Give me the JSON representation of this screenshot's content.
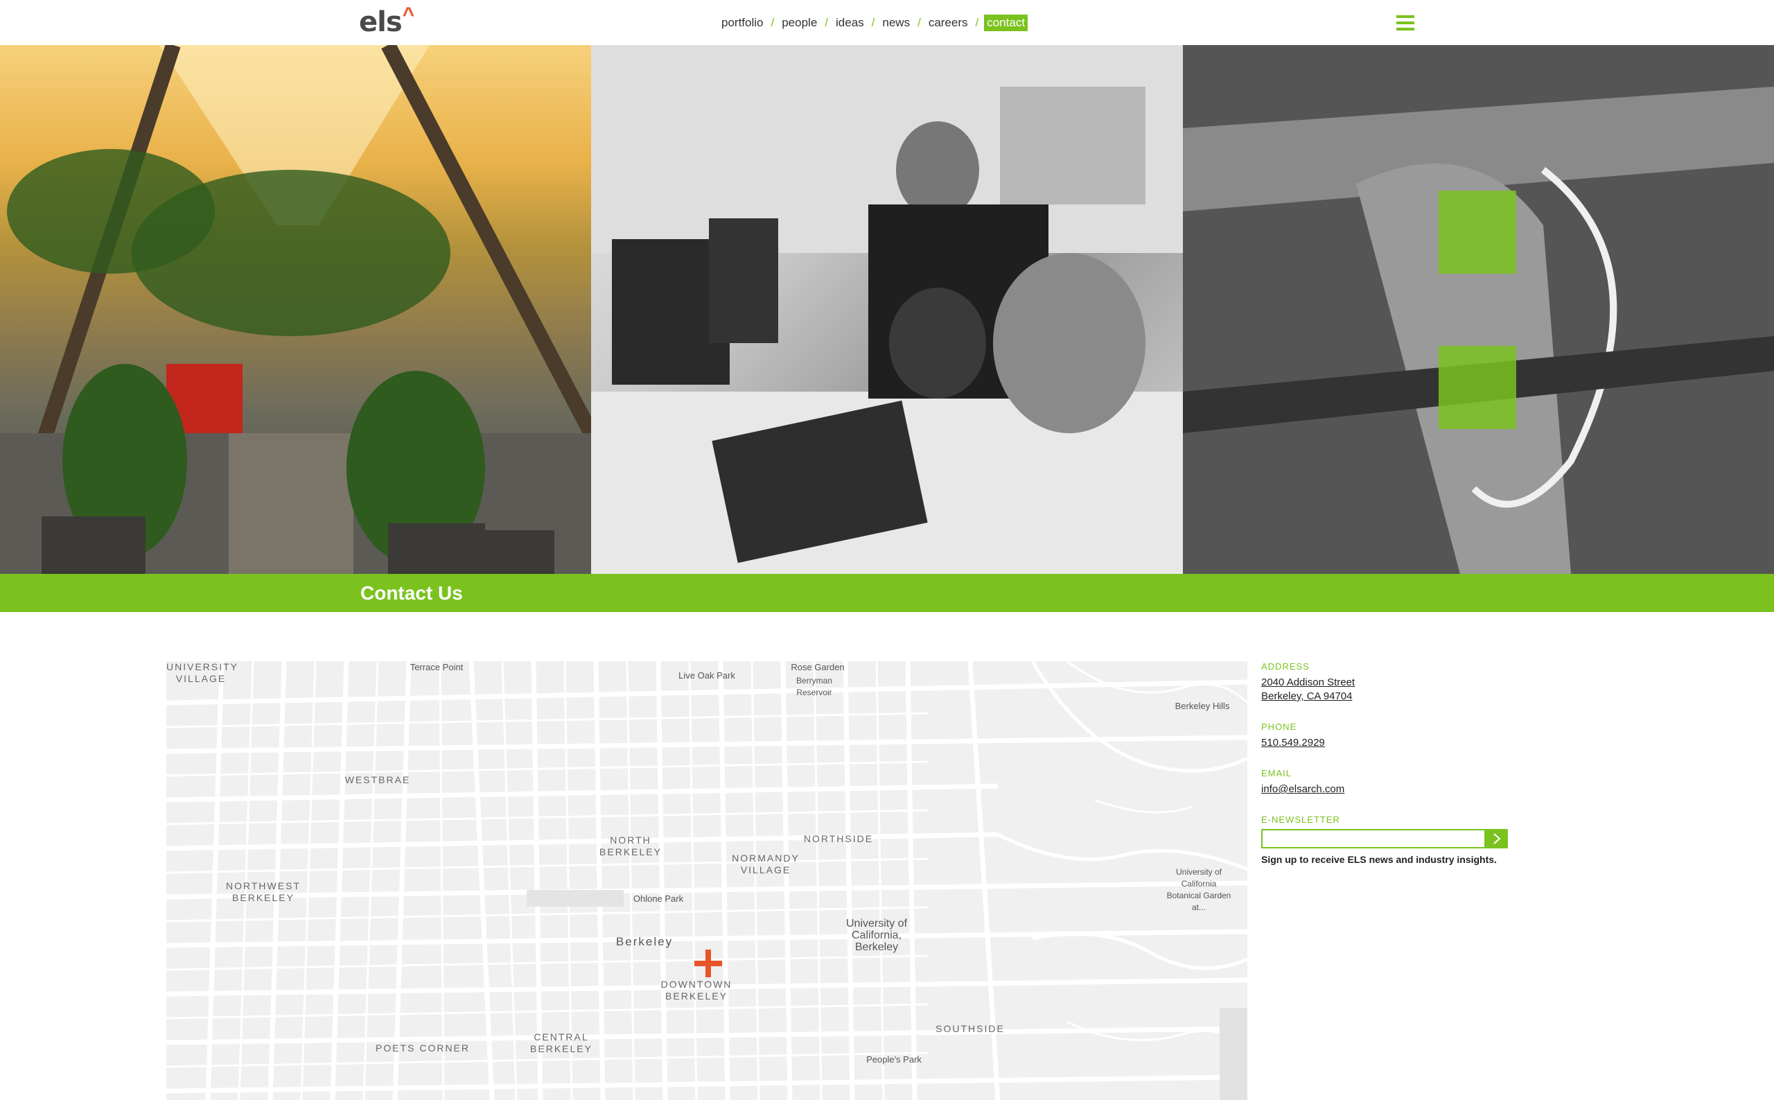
{
  "header": {
    "logo_text": "els",
    "logo_caret": "^",
    "nav": [
      {
        "label": "portfolio",
        "active": false
      },
      {
        "label": "people",
        "active": false
      },
      {
        "label": "ideas",
        "active": false
      },
      {
        "label": "news",
        "active": false
      },
      {
        "label": "careers",
        "active": false
      },
      {
        "label": "contact",
        "active": true
      }
    ],
    "nav_separator": "/",
    "menu_icon": "hamburger-icon"
  },
  "hero": {
    "panels": [
      "office-atrium-photo",
      "team-at-computer-photo",
      "bicycle-handlebar-photo"
    ]
  },
  "band": {
    "title": "Contact Us"
  },
  "map": {
    "labels": {
      "university_village": "UNIVERSITY VILLAGE",
      "westbrae": "WESTBRAE",
      "northwest_berkeley": "NORTHWEST BERKELEY",
      "north_berkeley": "NORTH BERKELEY",
      "normandy_village": "NORMANDY VILLAGE",
      "northside": "NORTHSIDE",
      "berkeley": "Berkeley",
      "uc_berkeley": "University of California, Berkeley",
      "downtown_berkeley": "DOWNTOWN BERKELEY",
      "poets_corner": "POETS CORNER",
      "central_berkeley": "CENTRAL BERKELEY",
      "southside": "SOUTHSIDE",
      "berkeley_hills": "Berkeley Hills",
      "live_oak_park": "Live Oak Park",
      "rose_garden": "Rose Garden",
      "berryman_reservoir": "Berryman Reservoir",
      "ohlone_park": "Ohlone Park",
      "peoples_park": "People's Park",
      "terrace_point": "Terrace Point",
      "botanical_garden": "University of California Botanical Garden at..."
    },
    "pin_icon": "map-pin-cross-icon"
  },
  "contact": {
    "address_label": "ADDRESS",
    "address_line1": "2040 Addison Street",
    "address_line2": "Berkeley, CA 94704",
    "phone_label": "PHONE",
    "phone": "510.549.2929",
    "email_label": "EMAIL",
    "email": "info@elsarch.com",
    "newsletter_label": "E-NEWSLETTER",
    "newsletter_value": "",
    "newsletter_note": "Sign up to receive ELS news and industry insights.",
    "submit_icon": "chevron-right-icon"
  },
  "colors": {
    "accent": "#7bc21f",
    "logo_caret": "#e8542a",
    "pin": "#e8542a"
  }
}
